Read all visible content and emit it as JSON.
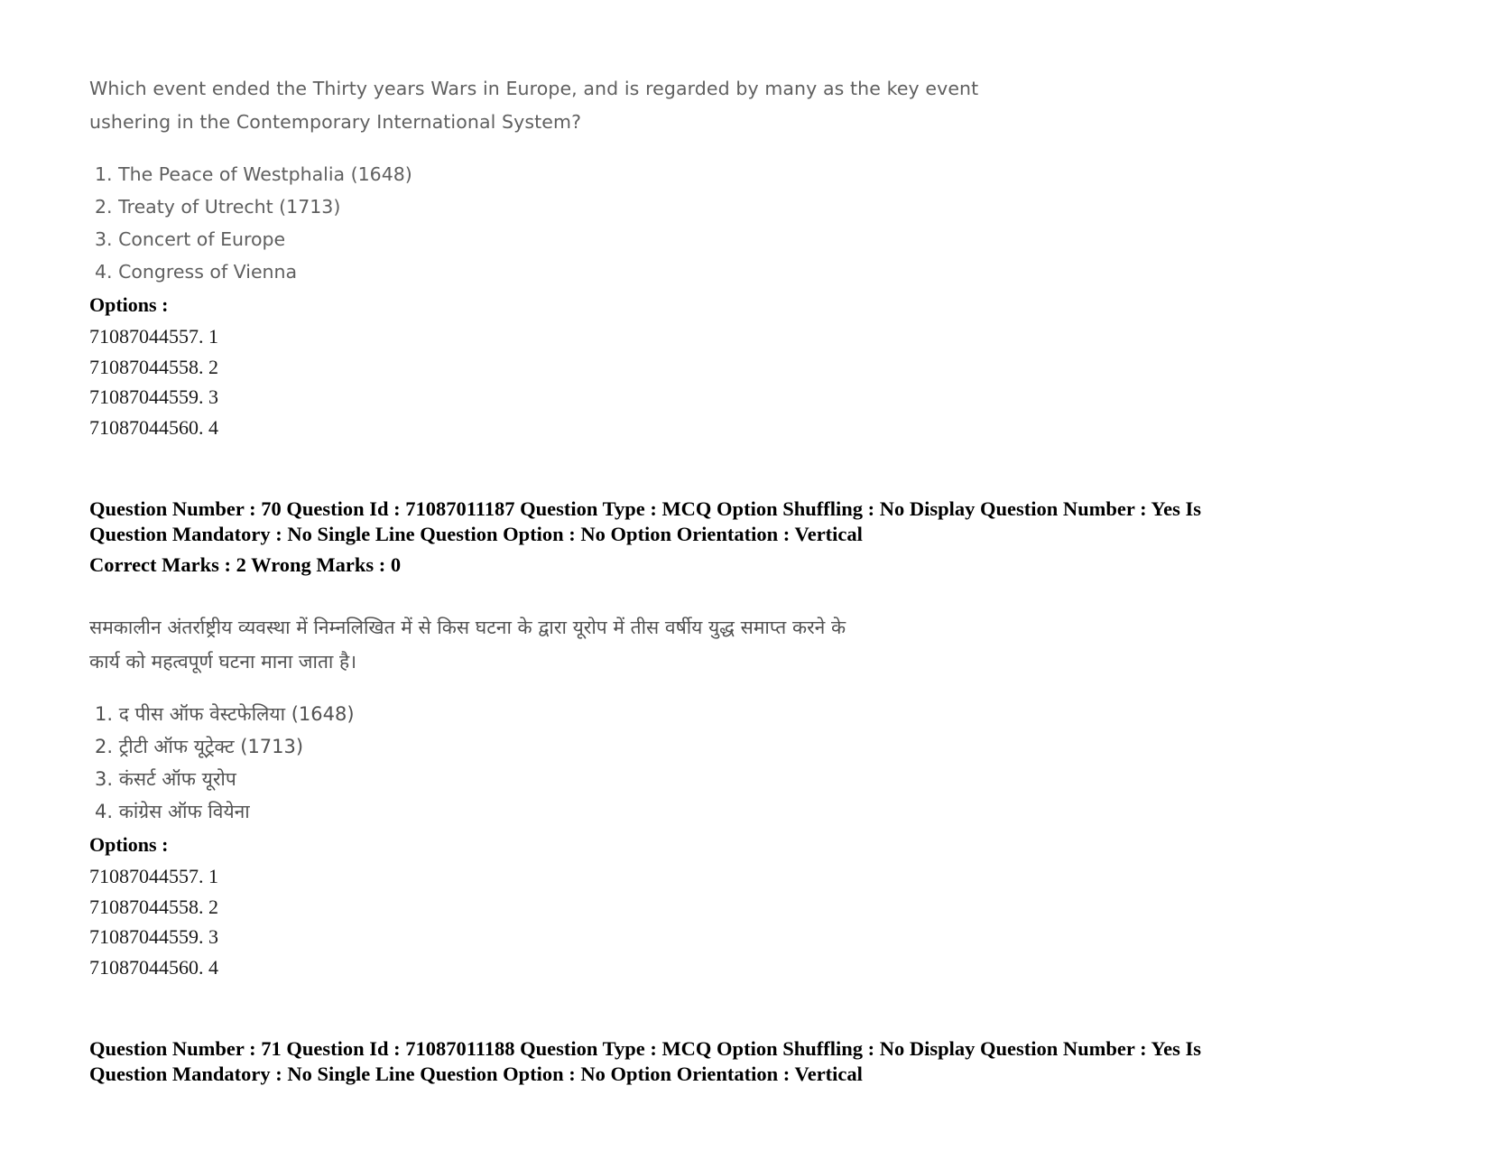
{
  "document": {
    "type": "exam-question-paper",
    "language_pairs": [
      "English",
      "Hindi"
    ]
  },
  "question_en": {
    "stem_lines": [
      "Which event ended the Thirty years Wars in Europe, and is regarded by many as the key event",
      "ushering in the Contemporary International System?"
    ],
    "choices": [
      "1. The Peace of Westphalia (1648)",
      "2. Treaty of Utrecht (1713)",
      "3. Concert of Europe",
      "4. Congress of Vienna"
    ],
    "options_label": "Options :",
    "option_ids": [
      "71087044557. 1",
      "71087044558. 2",
      "71087044559. 3",
      "71087044560. 4"
    ]
  },
  "meta_q70": {
    "line1": "Question Number : 70 Question Id : 71087011187 Question Type : MCQ Option Shuffling : No Display Question Number : Yes Is",
    "line2": "Question Mandatory : No Single Line Question Option : No Option Orientation : Vertical",
    "marks": "Correct Marks : 2 Wrong Marks : 0"
  },
  "question_hi": {
    "stem_lines": [
      "समकालीन अंतर्राष्ट्रीय व्यवस्था में निम्नलिखित में से किस घटना के द्वारा यूरोप में तीस वर्षीय युद्ध समाप्त करने के",
      "कार्य को महत्वपूर्ण घटना माना जाता है।"
    ],
    "choices": [
      "1. द पीस ऑफ वेस्टफेलिया (1648)",
      "2. ट्रीटी ऑफ यूट्रेक्ट (1713)",
      "3. कंसर्ट ऑफ यूरोप",
      "4. कांग्रेस ऑफ वियेना"
    ],
    "options_label": "Options :",
    "option_ids": [
      "71087044557. 1",
      "71087044558. 2",
      "71087044559. 3",
      "71087044560. 4"
    ]
  },
  "meta_q71": {
    "line1": "Question Number : 71 Question Id : 71087011188 Question Type : MCQ Option Shuffling : No Display Question Number : Yes Is",
    "line2": "Question Mandatory : No Single Line Question Option : No Option Orientation : Vertical"
  }
}
